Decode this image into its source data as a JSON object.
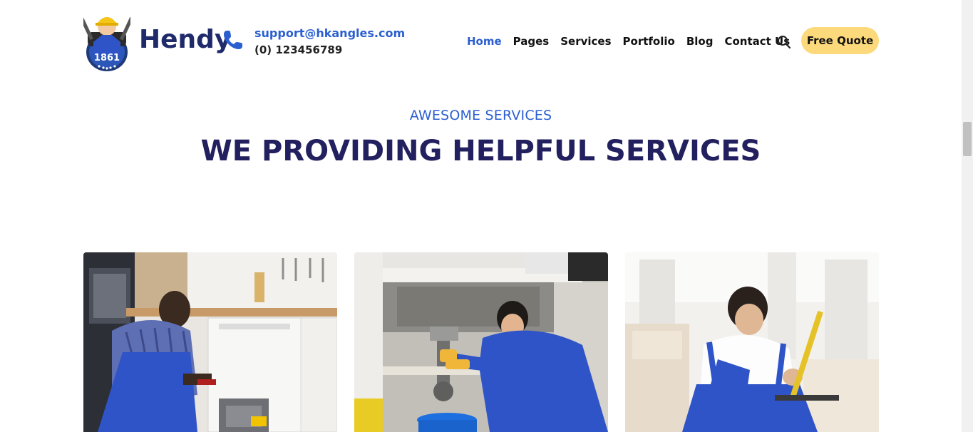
{
  "header": {
    "brand": "Hendy",
    "email": "support@hkangles.com",
    "phone": "(0) 123456789",
    "nav": [
      {
        "label": "Home",
        "active": true
      },
      {
        "label": "Pages",
        "active": false
      },
      {
        "label": "Services",
        "active": false
      },
      {
        "label": "Portfolio",
        "active": false
      },
      {
        "label": "Blog",
        "active": false
      },
      {
        "label": "Contact Us",
        "active": false
      }
    ],
    "search_icon": "search-icon",
    "quote_label": "Free Quote"
  },
  "section": {
    "eyebrow": "AWESOME SERVICES",
    "heading": "WE PROVIDING HELPFUL SERVICES"
  },
  "colors": {
    "accent": "#2b5fd0",
    "heading": "#23205f",
    "quote_button": "#fcd97a",
    "uniform": "#2f54c8"
  },
  "cards": [
    {
      "image": "technician-fixing-dishwasher-photo"
    },
    {
      "image": "plumber-under-sink-photo"
    },
    {
      "image": "carpenter-measuring-furniture-photo"
    }
  ]
}
